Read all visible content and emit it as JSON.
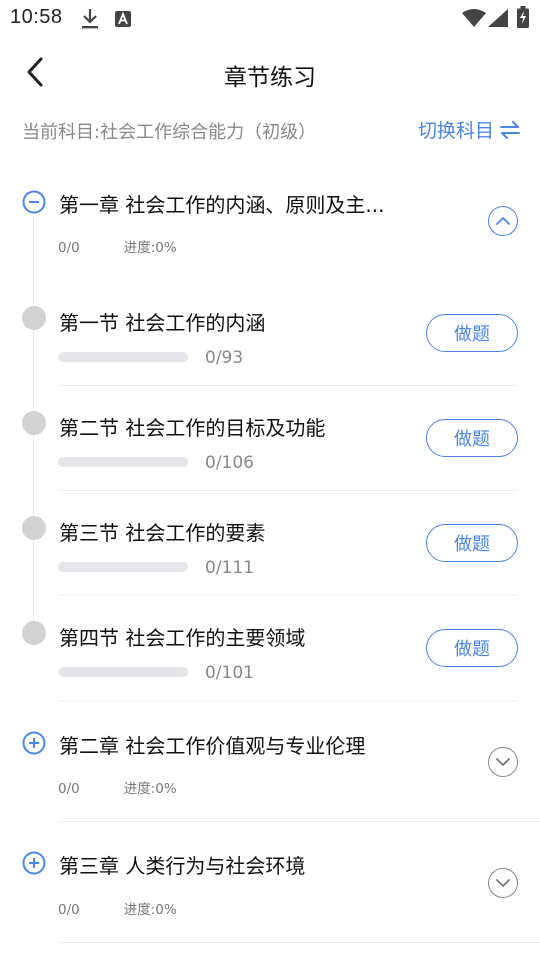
{
  "status_bar": {
    "time": "10:58",
    "left_icons": [
      "download-icon",
      "a-box-icon"
    ],
    "right_icons": [
      "wifi-icon",
      "signal-icon",
      "battery-charging-icon"
    ]
  },
  "header": {
    "title": "章节练习",
    "back_icon": "chevron-left-icon"
  },
  "subject": {
    "current_label": "当前科目:社会工作综合能力（初级）",
    "switch_label": "切换科目",
    "switch_icon": "swap-arrows-icon"
  },
  "accent_color": "#4a86e8",
  "chapters": [
    {
      "title": "第一章 社会工作的内涵、原则及主...",
      "count": "0/0",
      "progress": "进度:0%",
      "expanded": true,
      "sections": [
        {
          "title": "第一节 社会工作的内涵",
          "count": "0/93",
          "progress_fraction": 0,
          "button": "做题"
        },
        {
          "title": "第二节 社会工作的目标及功能",
          "count": "0/106",
          "progress_fraction": 0,
          "button": "做题"
        },
        {
          "title": "第三节 社会工作的要素",
          "count": "0/111",
          "progress_fraction": 0,
          "button": "做题"
        },
        {
          "title": "第四节 社会工作的主要领域",
          "count": "0/101",
          "progress_fraction": 0,
          "button": "做题"
        }
      ]
    },
    {
      "title": "第二章 社会工作价值观与专业伦理",
      "count": "0/0",
      "progress": "进度:0%",
      "expanded": false,
      "sections": []
    },
    {
      "title": "第三章 人类行为与社会环境",
      "count": "0/0",
      "progress": "进度:0%",
      "expanded": false,
      "sections": []
    }
  ]
}
